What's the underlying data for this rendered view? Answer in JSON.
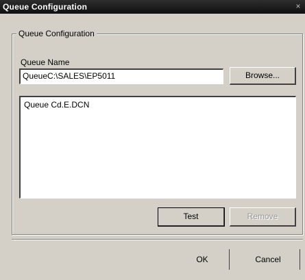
{
  "window": {
    "title": "Queue Configuration",
    "close_glyph": "×"
  },
  "group": {
    "legend": "Queue Configuration"
  },
  "queue_name": {
    "label": "Queue Name",
    "value": "QueueC:\\SALES\\EP5011",
    "browse_label": "Browse..."
  },
  "details": {
    "text": "Queue Cd.E.DCN"
  },
  "actions": {
    "test_label": "Test",
    "remove_label": "Remove"
  },
  "footer": {
    "ok_label": "OK",
    "cancel_label": "Cancel"
  }
}
